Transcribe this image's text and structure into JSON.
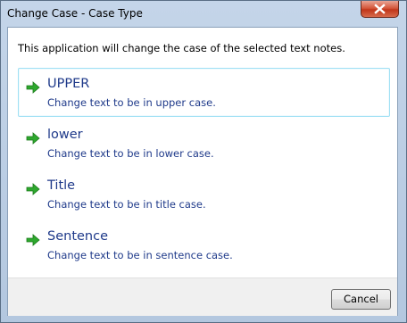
{
  "window": {
    "title": "Change Case - Case Type"
  },
  "dialog": {
    "intro_text": "This application will change the case of the selected text notes.",
    "options": [
      {
        "title": "UPPER",
        "description": "Change text to be in upper case.",
        "icon": "green-arrow-right-icon"
      },
      {
        "title": "lower",
        "description": "Change text to be in lower case.",
        "icon": "green-arrow-right-icon"
      },
      {
        "title": "Title",
        "description": "Change text to be in title case.",
        "icon": "green-arrow-right-icon"
      },
      {
        "title": "Sentence",
        "description": "Change text to be in sentence case.",
        "icon": "green-arrow-right-icon"
      }
    ],
    "cancel_label": "Cancel"
  },
  "colors": {
    "option_text": "#1f3a8a",
    "arrow": "#2ea82e",
    "hover_border": "#9fe0f4",
    "close_button": "#c7432a"
  }
}
